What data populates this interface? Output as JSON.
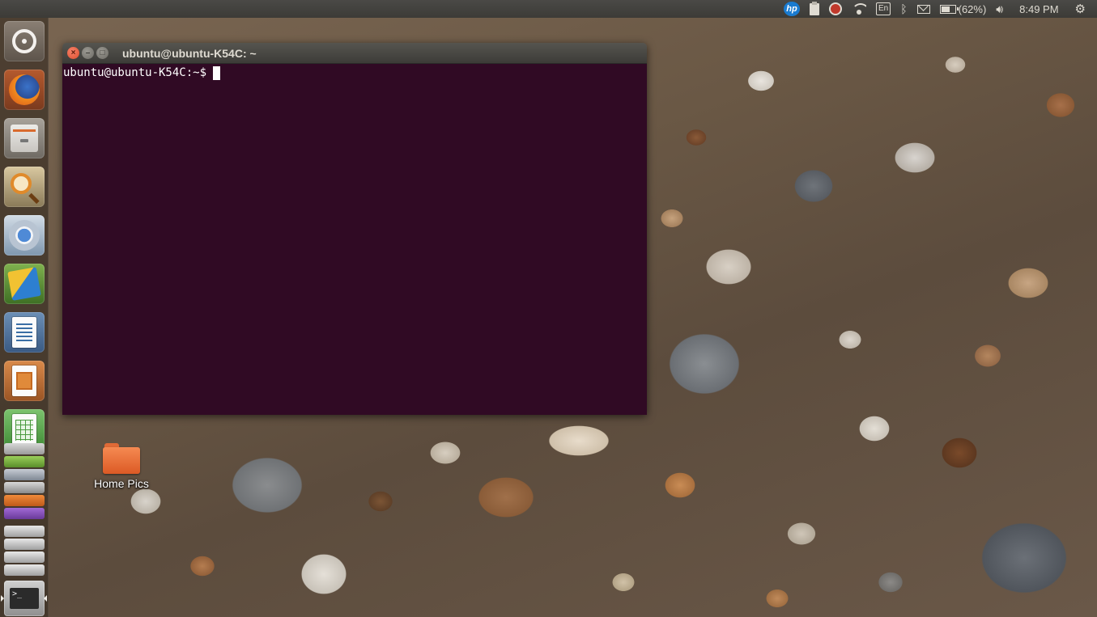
{
  "top_panel": {
    "indicators": [
      {
        "icon": "hp-logo-icon",
        "label": "hp"
      },
      {
        "icon": "clipboard-icon"
      },
      {
        "icon": "alarm-clock-icon"
      },
      {
        "icon": "wifi-icon"
      },
      {
        "icon": "keyboard-layout-icon",
        "label": "En"
      },
      {
        "icon": "bluetooth-icon"
      },
      {
        "icon": "mail-icon"
      },
      {
        "icon": "battery-icon"
      }
    ],
    "battery_percent": "(62%)",
    "clock": "8:49 PM"
  },
  "launcher": {
    "items": [
      {
        "name": "dash-home",
        "icon": "ubuntu-logo-icon"
      },
      {
        "name": "firefox",
        "icon": "firefox-icon"
      },
      {
        "name": "files",
        "icon": "file-cabinet-icon"
      },
      {
        "name": "search",
        "icon": "magnifier-icon"
      },
      {
        "name": "chromium",
        "icon": "chromium-icon"
      },
      {
        "name": "installer",
        "icon": "installer-icon"
      },
      {
        "name": "libreoffice-writer",
        "icon": "writer-icon"
      },
      {
        "name": "libreoffice-impress",
        "icon": "impress-icon"
      },
      {
        "name": "libreoffice-calc",
        "icon": "calc-icon"
      },
      {
        "name": "terminal",
        "icon": "terminal-icon",
        "active": true
      }
    ]
  },
  "desktop": {
    "icons": [
      {
        "label": "Home Pics",
        "icon": "folder-icon"
      }
    ]
  },
  "terminal": {
    "title": "ubuntu@ubuntu-K54C: ~",
    "prompt": "ubuntu@ubuntu-K54C:~$",
    "buttons": {
      "close": "×",
      "minimize": "–",
      "maximize": "□"
    },
    "colors": {
      "background": "#300a24",
      "foreground": "#ffffff"
    }
  },
  "term_icon_glyph": ">_"
}
